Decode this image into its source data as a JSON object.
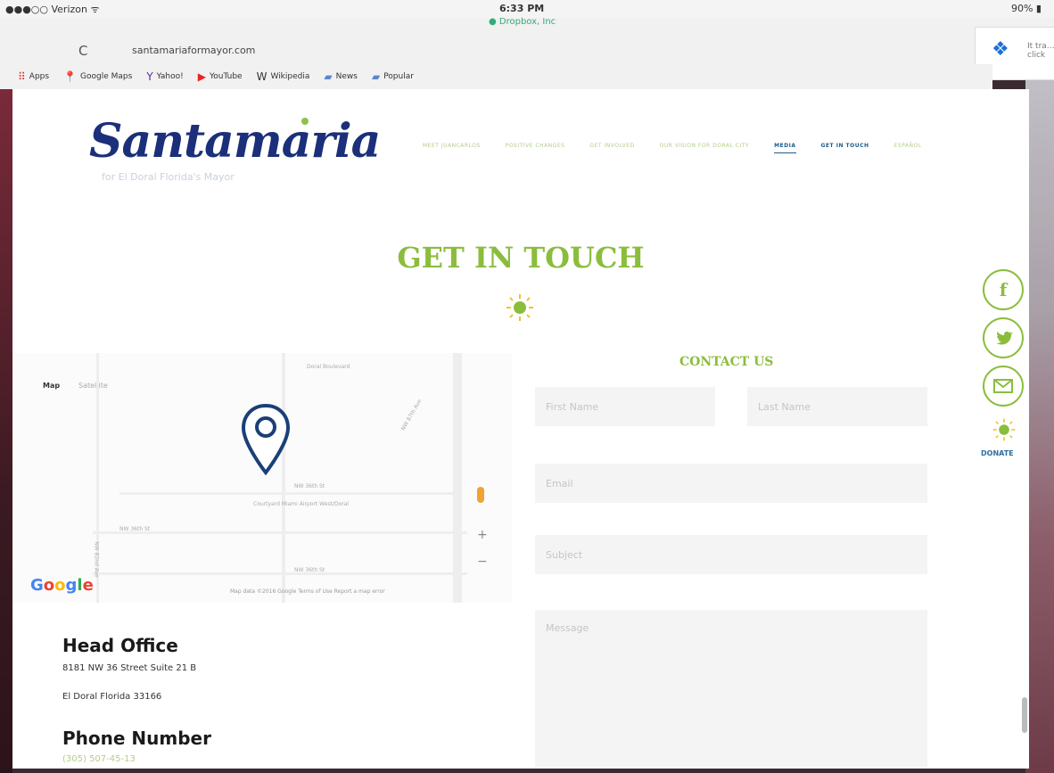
{
  "status_bar": {
    "carrier": "●●●○○ Verizon ᯤ",
    "time": "6:33 PM",
    "battery": "90%"
  },
  "browser": {
    "url": "santamariaformayor.com",
    "dropbox_note": "● Dropbox, Inc",
    "extension_text": "It tra… click",
    "bookmarks": [
      {
        "icon": "apps-grid-icon",
        "label": "Apps"
      },
      {
        "icon": "google-maps-icon",
        "label": "Google Maps"
      },
      {
        "icon": "yahoo-icon",
        "label": "Yahoo!"
      },
      {
        "icon": "youtube-icon",
        "label": "YouTube"
      },
      {
        "icon": "wikipedia-icon",
        "label": "Wikipedia"
      },
      {
        "icon": "folder-icon",
        "label": "News"
      },
      {
        "icon": "folder-icon",
        "label": "Popular"
      }
    ]
  },
  "site": {
    "logo": "Santamaria",
    "tagline": "for El Doral Florida's Mayor",
    "nav": [
      "MEET JUANCARLOS",
      "POSITIVE CHANGES",
      "GET INVOLVED",
      "OUR VISION FOR DORAL CITY",
      "MEDIA",
      "GET IN TOUCH",
      "ESPAÑOL"
    ],
    "section_title": "GET IN TOUCH",
    "map": {
      "tab_map": "Map",
      "tab_satellite": "Satellite",
      "google": "Google",
      "footer": "Map data ©2016 Google    Terms of Use    Report a map error",
      "labels": [
        "Doral Boulevard",
        "NW 36th St",
        "NW 36th St",
        "NW 36th St",
        "NW 87th Ave",
        "Courtyard Miami Airport West/Doral",
        "NW 82nd Ave"
      ]
    },
    "contact": {
      "title": "CONTACT US",
      "first_name": "First Name",
      "last_name": "Last Name",
      "email": "Email",
      "subject": "Subject",
      "message": "Message"
    },
    "office": {
      "heading": "Head Office",
      "line1": "8181 NW 36 Street Suite 21 B",
      "line2": "El Doral Florida 33166",
      "phone_heading": "Phone Number",
      "phone": "(305) 507-45-13"
    },
    "social": {
      "donate": "DONATE"
    },
    "colors": {
      "green": "#8bbd3d",
      "navy": "#1b2f7a",
      "blue": "#2c6ea0"
    }
  }
}
